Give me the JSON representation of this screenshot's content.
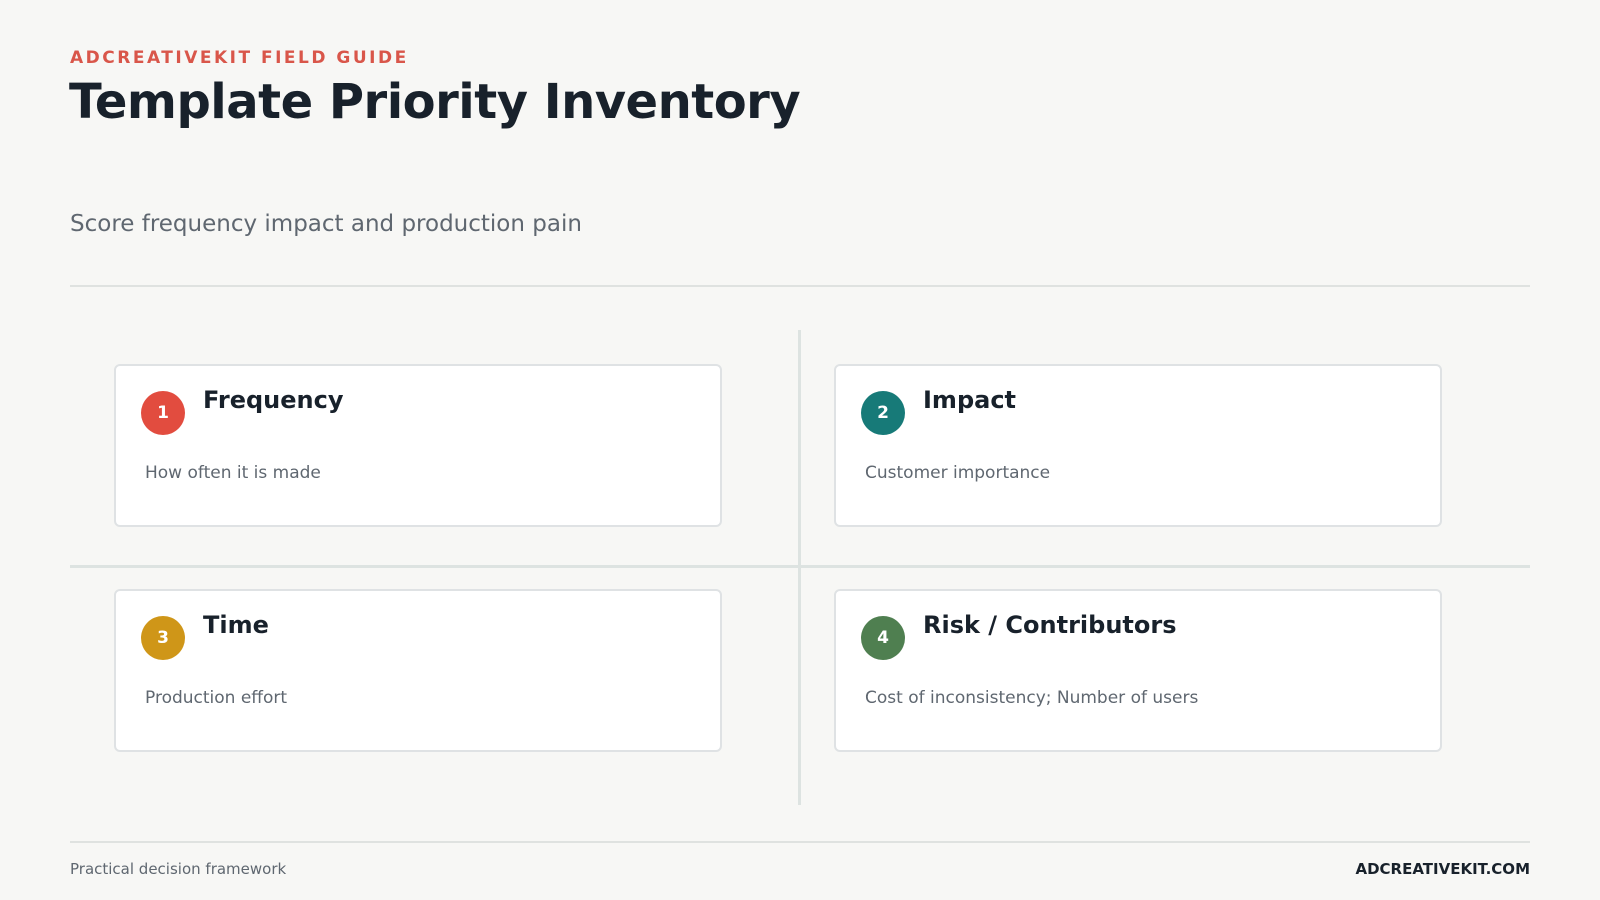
{
  "header": {
    "eyebrow": "ADCREATIVEKIT FIELD GUIDE",
    "title": "Template Priority Inventory",
    "subtitle": "Score frequency impact and production pain"
  },
  "cards": [
    {
      "number": "1",
      "title": "Frequency",
      "description": "How often it is made",
      "color": "#e24c3f"
    },
    {
      "number": "2",
      "title": "Impact",
      "description": "Customer importance",
      "color": "#177a78"
    },
    {
      "number": "3",
      "title": "Time",
      "description": "Production effort",
      "color": "#cf9618"
    },
    {
      "number": "4",
      "title": "Risk / Contributors",
      "description": "Cost of inconsistency; Number of users",
      "color": "#4f7f50"
    }
  ],
  "footer": {
    "left": "Practical decision framework",
    "right": "ADCREATIVEKIT.COM"
  },
  "colors": {
    "accent": "#d9564a",
    "text": "#18212b",
    "muted": "#5f6770",
    "background": "#f7f7f5"
  }
}
